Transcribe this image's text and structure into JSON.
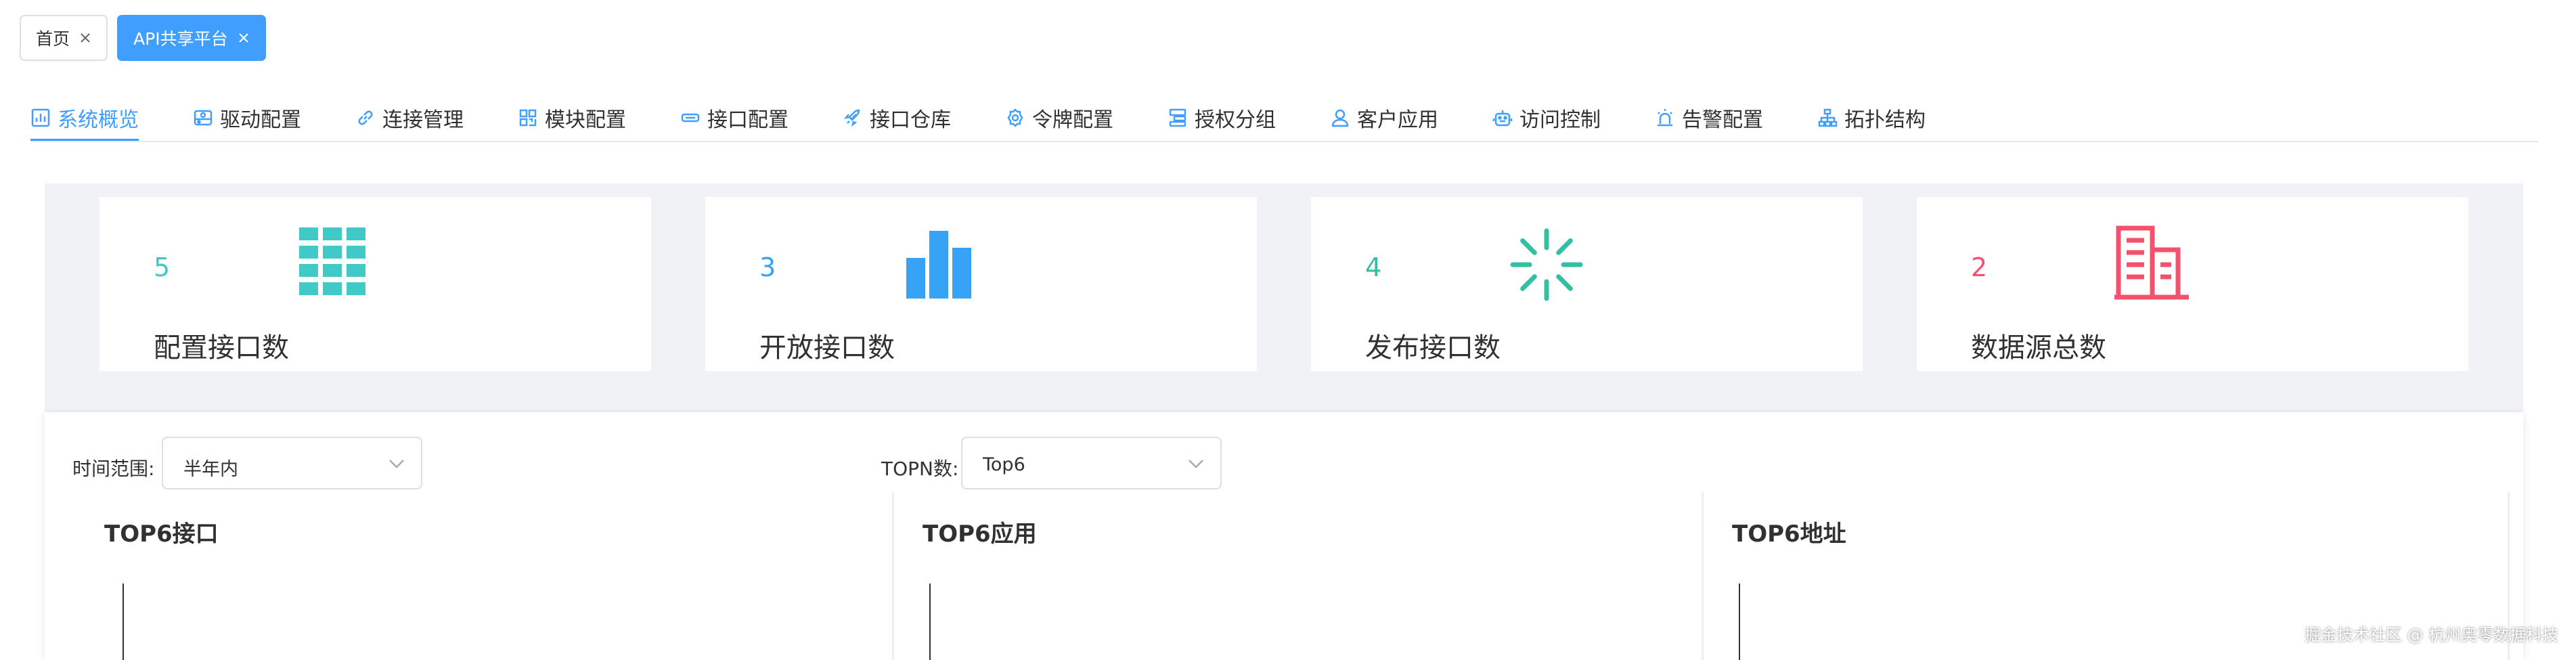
{
  "page_tabs": [
    {
      "label": "首页",
      "active": false
    },
    {
      "label": "API共享平台",
      "active": true
    }
  ],
  "nav": [
    {
      "label": "系统概览",
      "icon": "chart-icon"
    },
    {
      "label": "驱动配置",
      "icon": "drive-icon"
    },
    {
      "label": "连接管理",
      "icon": "link-icon"
    },
    {
      "label": "模块配置",
      "icon": "grid-icon"
    },
    {
      "label": "接口配置",
      "icon": "interface-icon"
    },
    {
      "label": "接口仓库",
      "icon": "rocket-icon"
    },
    {
      "label": "令牌配置",
      "icon": "gear-icon"
    },
    {
      "label": "授权分组",
      "icon": "group-icon"
    },
    {
      "label": "客户应用",
      "icon": "user-icon"
    },
    {
      "label": "访问控制",
      "icon": "robot-icon"
    },
    {
      "label": "告警配置",
      "icon": "alarm-icon"
    },
    {
      "label": "拓扑结构",
      "icon": "topology-icon"
    }
  ],
  "colors": {
    "accent": "#409eff",
    "teal": "#40c9c6",
    "blue": "#36a3f7",
    "green": "#34bfa3",
    "red": "#f4516c"
  },
  "stats": [
    {
      "value": "5",
      "label": "配置接口数",
      "icon": "grid-icon"
    },
    {
      "value": "3",
      "label": "开放接口数",
      "icon": "bar-chart-icon"
    },
    {
      "value": "4",
      "label": "发布接口数",
      "icon": "loading-icon"
    },
    {
      "value": "2",
      "label": "数据源总数",
      "icon": "building-icon"
    }
  ],
  "filters": {
    "time_label": "时间范围:",
    "time_value": "半年内",
    "topn_label": "TOPN数:",
    "topn_value": "Top6"
  },
  "charts": [
    {
      "title": "TOP6接口"
    },
    {
      "title": "TOP6应用"
    },
    {
      "title": "TOP6地址"
    }
  ],
  "watermark": "掘金技术社区 @ 杭州奥零数据科技"
}
